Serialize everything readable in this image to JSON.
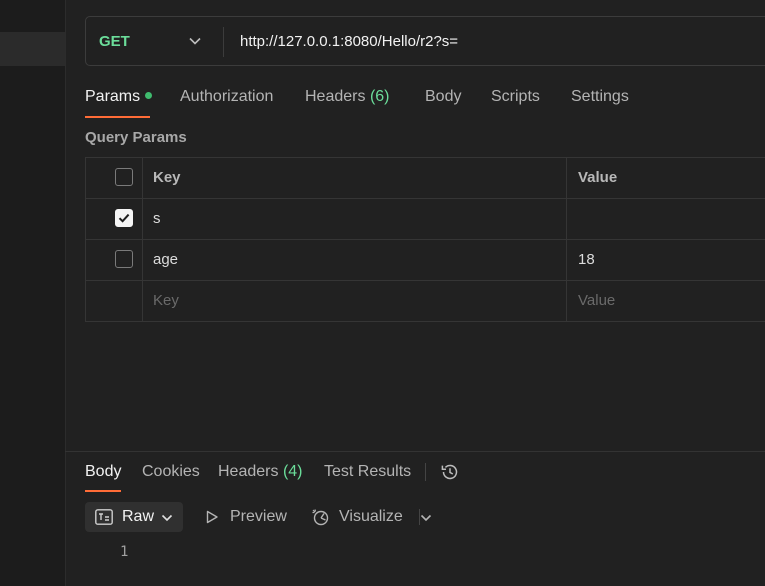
{
  "request": {
    "method": "GET",
    "url": "http://127.0.0.1:8080/Hello/r2?s="
  },
  "request_tabs": [
    {
      "label": "Params",
      "active": true,
      "has_dot": true
    },
    {
      "label": "Authorization"
    },
    {
      "label": "Headers",
      "count": "(6)"
    },
    {
      "label": "Body"
    },
    {
      "label": "Scripts"
    },
    {
      "label": "Settings"
    }
  ],
  "query_params": {
    "title": "Query Params",
    "headers": {
      "key": "Key",
      "value": "Value"
    },
    "rows": [
      {
        "key": "s",
        "value": "",
        "checked": true
      },
      {
        "key": "age",
        "value": "18",
        "checked": false
      }
    ],
    "placeholder": {
      "key": "Key",
      "value": "Value"
    }
  },
  "response_tabs": [
    {
      "label": "Body",
      "active": true
    },
    {
      "label": "Cookies"
    },
    {
      "label": "Headers",
      "count": "(4)"
    },
    {
      "label": "Test Results"
    }
  ],
  "response_toolbar": {
    "raw": "Raw",
    "preview": "Preview",
    "visualize": "Visualize"
  },
  "response_body": {
    "line_numbers": [
      "1"
    ]
  },
  "icons": {
    "method_dropdown": "chevron-down-icon",
    "history": "history-icon",
    "raw_format": "text-format-icon",
    "preview": "play-icon",
    "visualize": "visualize-icon",
    "checkbox_checked": "check-icon"
  },
  "colors": {
    "method": "#6bdd9a",
    "count": "#6bdd9a",
    "accent_underline": "#ff6c37",
    "status_dot": "#3fbb6e",
    "background": "#212121"
  }
}
